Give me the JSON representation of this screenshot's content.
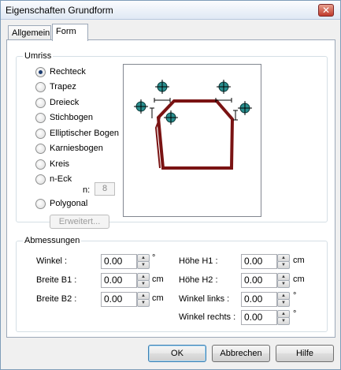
{
  "window": {
    "title": "Eigenschaften Grundform",
    "close_glyph": "✕"
  },
  "tabs": [
    {
      "label": "Allgemein"
    },
    {
      "label": "Form"
    }
  ],
  "umriss": {
    "title": "Umriss",
    "options": [
      {
        "label": "Rechteck",
        "checked": true
      },
      {
        "label": "Trapez",
        "checked": false
      },
      {
        "label": "Dreieck",
        "checked": false
      },
      {
        "label": "Stichbogen",
        "checked": false
      },
      {
        "label": "Elliptischer Bogen",
        "checked": false
      },
      {
        "label": "Karniesbogen",
        "checked": false
      },
      {
        "label": "Kreis",
        "checked": false
      },
      {
        "label": "n-Eck",
        "checked": false
      },
      {
        "label": "Polygonal",
        "checked": false
      }
    ],
    "n_label": "n:",
    "n_value": "8",
    "advanced_button": "Erweitert...",
    "shape_color": "#7a1313",
    "handle_color": "#2a8f8f"
  },
  "dimensions": {
    "title": "Abmessungen",
    "left": [
      {
        "label": "Winkel :",
        "value": "0.00",
        "unit": "°"
      },
      {
        "label": "Breite B1 :",
        "value": "0.00",
        "unit": "cm"
      },
      {
        "label": "Breite B2 :",
        "value": "0.00",
        "unit": "cm"
      }
    ],
    "right": [
      {
        "label": "Höhe H1 :",
        "value": "0.00",
        "unit": "cm"
      },
      {
        "label": "Höhe H2 :",
        "value": "0.00",
        "unit": "cm"
      },
      {
        "label": "Winkel links :",
        "value": "0.00",
        "unit": "°"
      },
      {
        "label": "Winkel rechts :",
        "value": "0.00",
        "unit": "°"
      }
    ]
  },
  "buttons": {
    "ok": "OK",
    "cancel": "Abbrechen",
    "help": "Hilfe"
  }
}
